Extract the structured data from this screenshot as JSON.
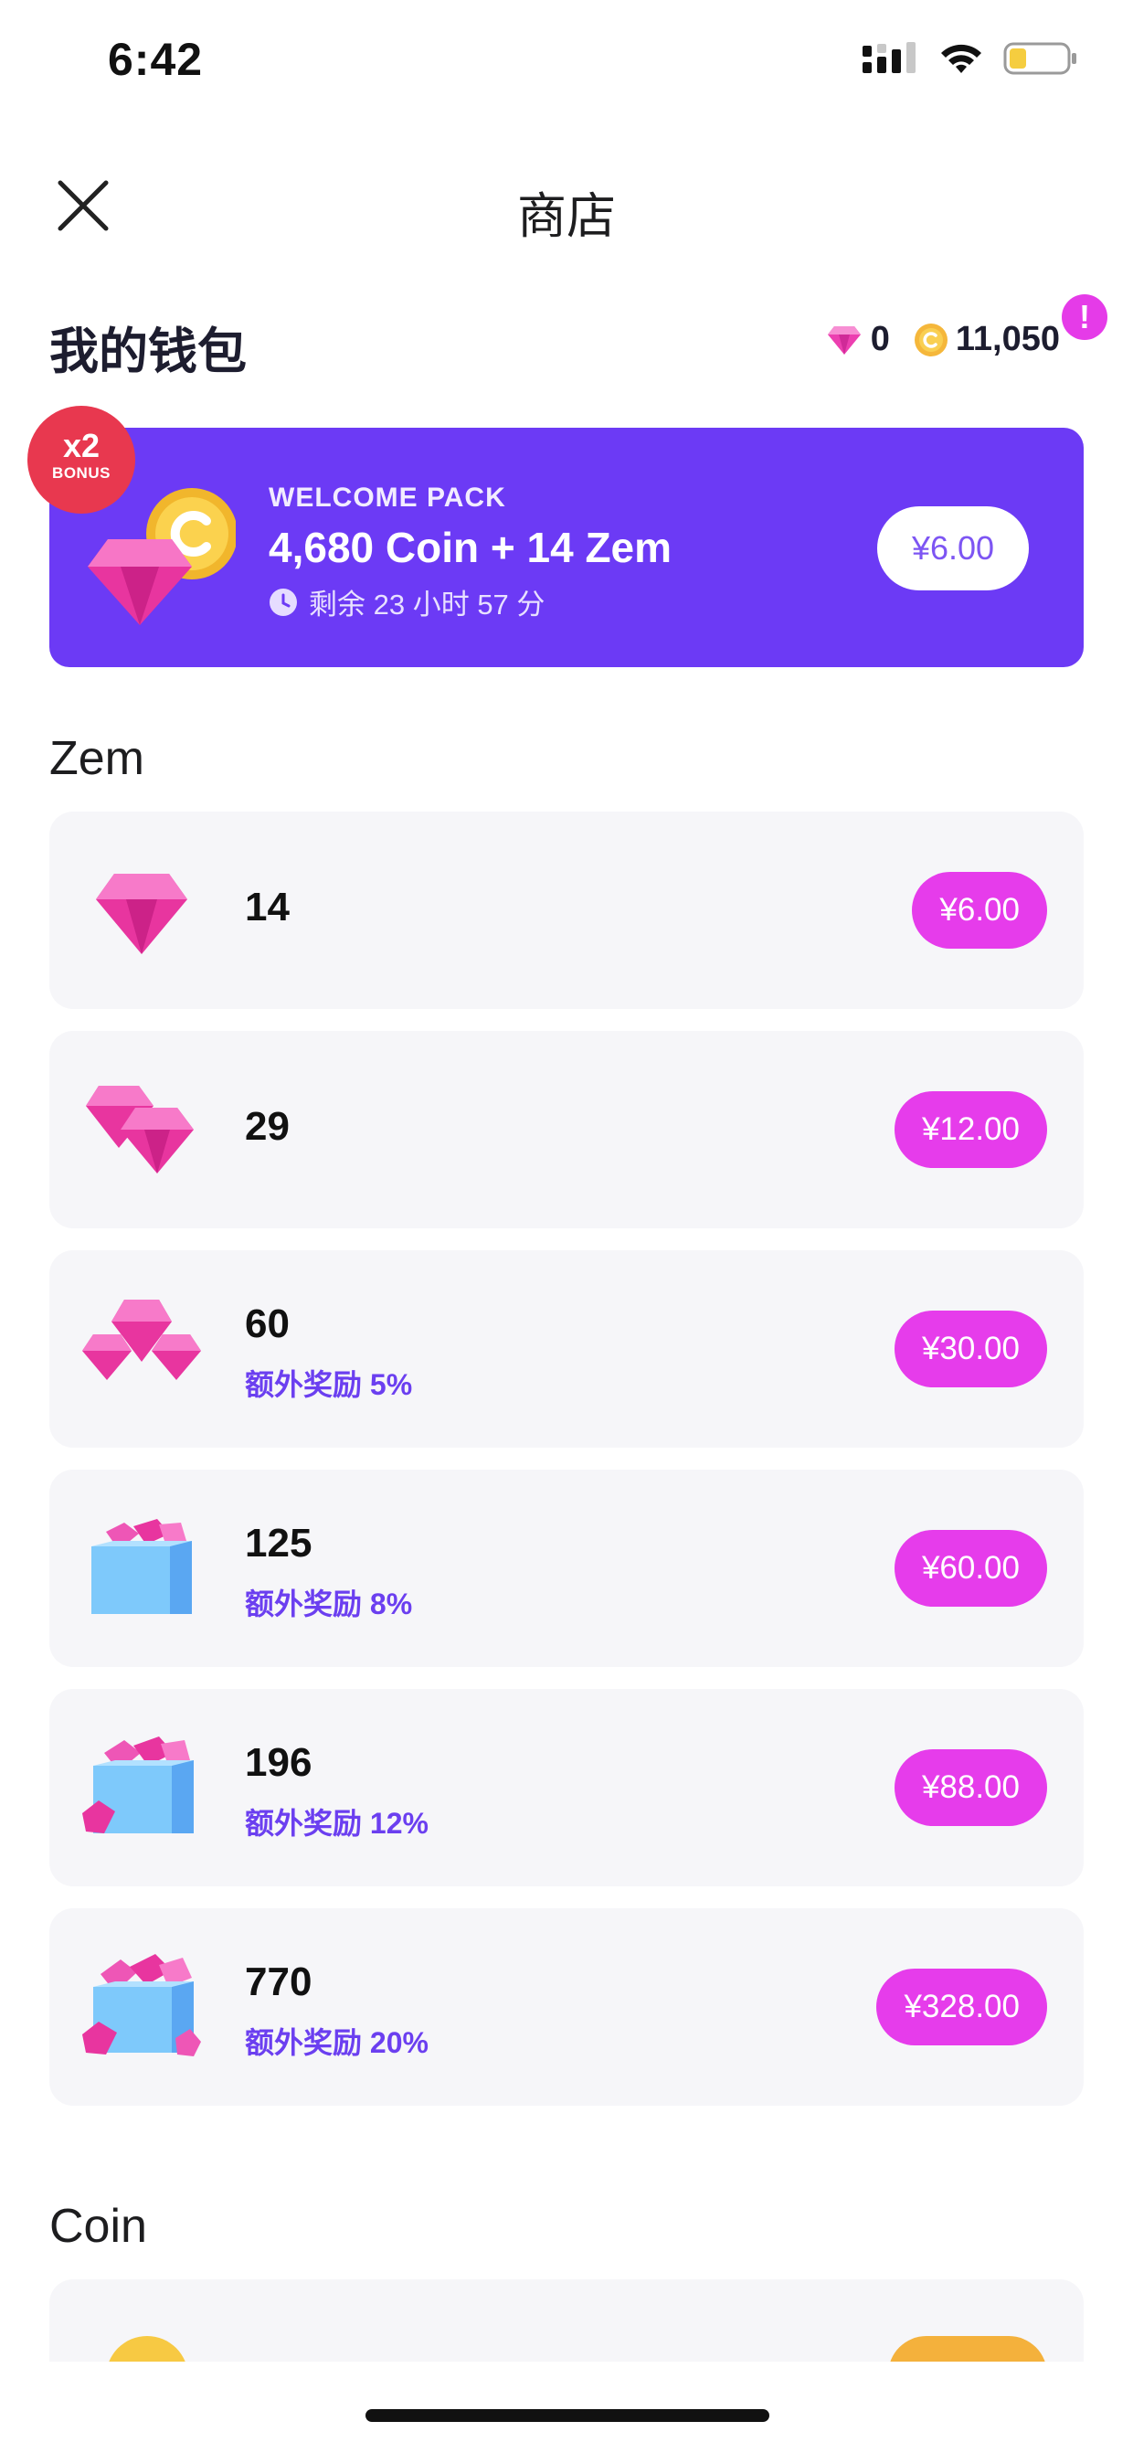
{
  "status_bar": {
    "time": "6:42"
  },
  "header": {
    "title": "商店"
  },
  "wallet": {
    "title": "我的钱包",
    "zem_balance": "0",
    "coin_balance": "11,050",
    "alert_symbol": "!"
  },
  "welcome_pack": {
    "bonus_multiplier": "x2",
    "bonus_label": "BONUS",
    "kicker": "WELCOME PACK",
    "title": "4,680 Coin + 14 Zem",
    "timer": "剩余 23 小时 57 分",
    "price": "¥6.00"
  },
  "zem_section": {
    "title": "Zem",
    "items": [
      {
        "amount": "14",
        "bonus": "",
        "price": "¥6.00",
        "icon": "single-gem-icon"
      },
      {
        "amount": "29",
        "bonus": "",
        "price": "¥12.00",
        "icon": "double-gem-icon"
      },
      {
        "amount": "60",
        "bonus": "额外奖励 5%",
        "price": "¥30.00",
        "icon": "gem-cluster-icon"
      },
      {
        "amount": "125",
        "bonus": "额外奖励 8%",
        "price": "¥60.00",
        "icon": "gem-box-icon"
      },
      {
        "amount": "196",
        "bonus": "额外奖励 12%",
        "price": "¥88.00",
        "icon": "gem-box-icon"
      },
      {
        "amount": "770",
        "bonus": "额外奖励 20%",
        "price": "¥328.00",
        "icon": "gem-box-overflow-icon"
      }
    ]
  },
  "coin_section": {
    "title": "Coin"
  },
  "colors": {
    "accent_purple": "#6c3af5",
    "price_pink": "#e63ceb",
    "bonus_red": "#e8384f",
    "coin_gold": "#f7c943"
  }
}
